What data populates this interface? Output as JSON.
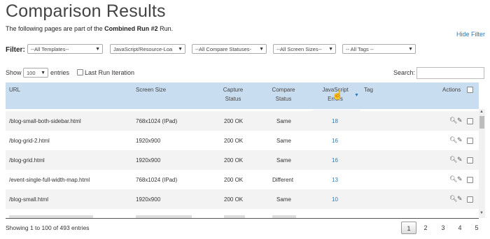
{
  "page": {
    "title": "Comparison Results",
    "subtitle_prefix": "The following pages are part of the ",
    "subtitle_run": "Combined Run #2",
    "subtitle_suffix": " Run.",
    "hide_filter": "Hide Filter"
  },
  "filter": {
    "label": "Filter:",
    "templates": "--All Templates--",
    "resource": "JavaScript/Resource-Loa",
    "statuses": "--All Compare Statuses-",
    "screen_sizes": "--All Screen Sizes--",
    "tags": "-- All Tags --"
  },
  "controls": {
    "show": "Show",
    "show_value": "100",
    "entries": "entries",
    "last_run": "Last Run Iteration",
    "search": "Search:"
  },
  "table": {
    "headers": {
      "url": "URL",
      "screen": "Screen Size",
      "capture1": "Capture",
      "capture2": "Status",
      "compare1": "Compare",
      "compare2": "Status",
      "js1": "JavaScript",
      "js2": "Errors",
      "tag": "Tag",
      "actions": "Actions"
    },
    "rows": [
      {
        "url": "/blog-small-both-sidebar.html",
        "screen": "768x1024 (IPad)",
        "capture": "200 OK",
        "compare": "Same",
        "js": "18"
      },
      {
        "url": "/blog-grid-2.html",
        "screen": "1920x900",
        "capture": "200 OK",
        "compare": "Same",
        "js": "16"
      },
      {
        "url": "/blog-grid.html",
        "screen": "1920x900",
        "capture": "200 OK",
        "compare": "Same",
        "js": "16"
      },
      {
        "url": "/event-single-full-width-map.html",
        "screen": "768x1024 (IPad)",
        "capture": "200 OK",
        "compare": "Different",
        "js": "13"
      },
      {
        "url": "/blog-small.html",
        "screen": "1920x900",
        "capture": "200 OK",
        "compare": "Same",
        "js": "10"
      }
    ]
  },
  "footer": {
    "showing": "Showing 1 to 100 of 493 entries",
    "pages": [
      "1",
      "2",
      "3",
      "4",
      "5"
    ]
  },
  "icons": {
    "dropdown": "caret-down-icon",
    "sort": "sort-desc-icon",
    "view": "magnifier-icon",
    "edit": "pencil-icon",
    "cursor": "hand-cursor-icon"
  }
}
